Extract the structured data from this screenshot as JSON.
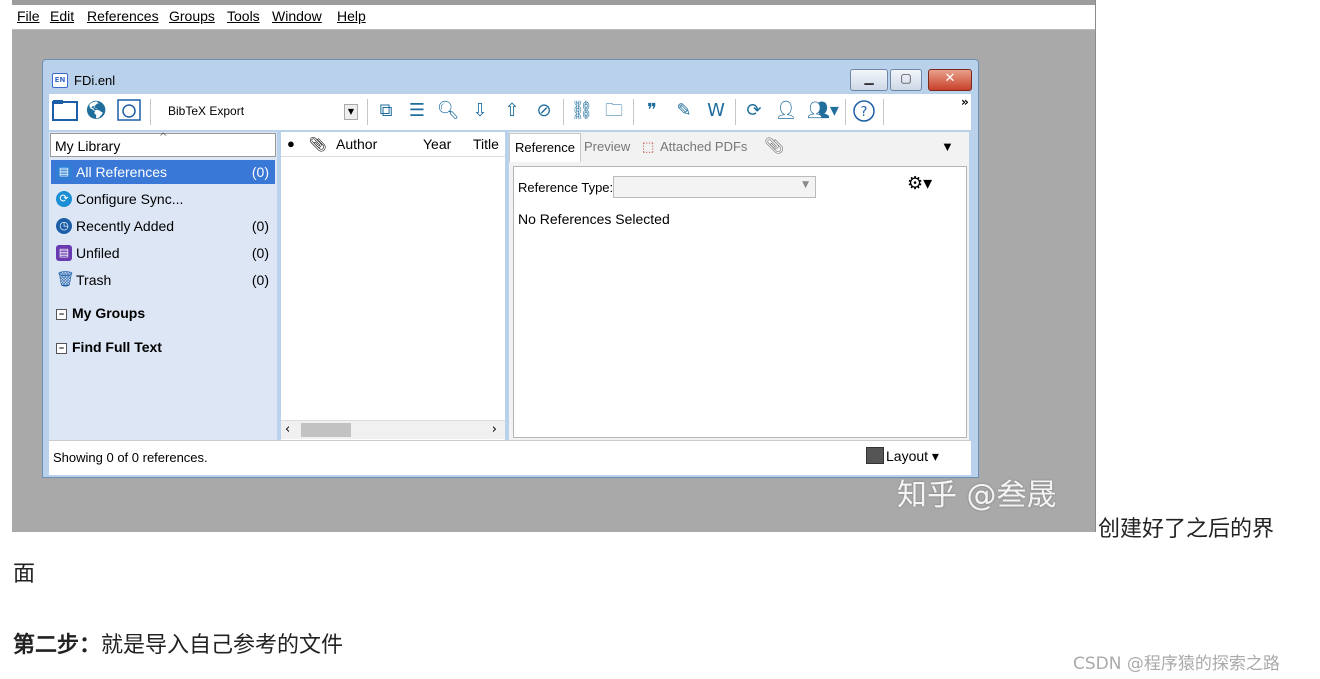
{
  "menu": [
    "File",
    "Edit",
    "References",
    "Groups",
    "Tools",
    "Window",
    "Help"
  ],
  "window": {
    "title": "FDi.enl",
    "icon_text": "EN"
  },
  "toolbar": {
    "style_select": "BibTeX Export",
    "overflow": "»"
  },
  "library": {
    "header": "My Library",
    "groups": [
      {
        "name": "All References",
        "count": "(0)",
        "icon": "all-references-icon"
      },
      {
        "name": "Configure Sync...",
        "count": "",
        "icon": "sync-icon"
      },
      {
        "name": "Recently Added",
        "count": "(0)",
        "icon": "clock-icon"
      },
      {
        "name": "Unfiled",
        "count": "(0)",
        "icon": "unfiled-icon"
      },
      {
        "name": "Trash",
        "count": "(0)",
        "icon": "trash-icon"
      }
    ],
    "sections": [
      "My Groups",
      "Find Full Text"
    ]
  },
  "columns": {
    "author": "Author",
    "year": "Year",
    "title": "Title"
  },
  "tabs": [
    "Reference",
    "Preview",
    "Attached PDFs"
  ],
  "reference_panel": {
    "type_label": "Reference Type:",
    "empty": "No References Selected"
  },
  "status": {
    "text": "Showing 0 of 0 references.",
    "layout": "Layout"
  },
  "watermark": "知乎 @叁晟",
  "caption": {
    "line1": "创建好了之后的界",
    "line2": "面"
  },
  "step": {
    "bold": "第二步：",
    "text": "就是导入自己参考的文件"
  },
  "credit": "CSDN @程序猿的探索之路"
}
